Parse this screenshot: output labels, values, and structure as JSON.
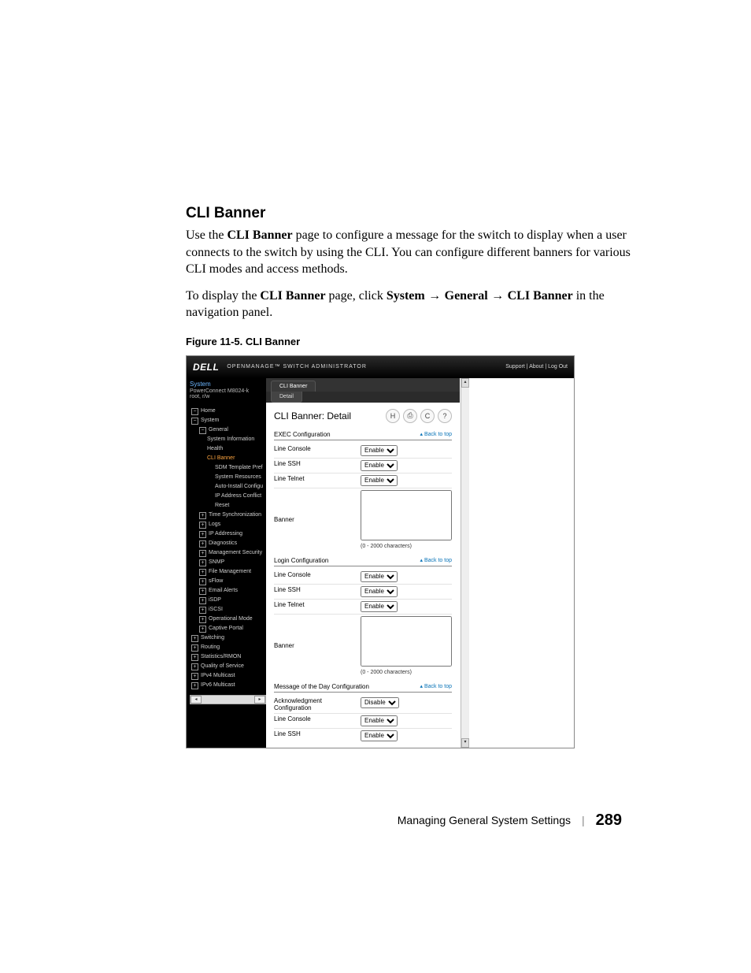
{
  "doc": {
    "heading": "CLI Banner",
    "para1_a": "Use the ",
    "para1_b": "CLI Banner",
    "para1_c": " page to configure a message for the switch to display when a user connects to the switch by using the CLI. You can configure different banners for various CLI modes and access methods.",
    "para2_a": "To display the ",
    "para2_b": "CLI Banner",
    "para2_c": " page, click ",
    "nav1": "System",
    "nav2": "General",
    "nav3": "CLI Banner",
    "para2_d": " in the navigation panel.",
    "figcaption": "Figure 11-5.    CLI Banner"
  },
  "top": {
    "logo": "DELL",
    "subtitle": "OPENMANAGE™  SWITCH  ADMINISTRATOR",
    "links": "Support  |  About  |  Log Out"
  },
  "side": {
    "system": "System",
    "device": "PowerConnect M8024-k",
    "user": "root, r/w",
    "items": {
      "home": "Home",
      "system2": "System",
      "general": "General",
      "sysinfo": "System Information",
      "health": "Health",
      "cli": "CLI Banner",
      "sdm": "SDM Template Pref",
      "sysres": "System Resources",
      "auto": "Auto-Install Configu",
      "ipconf": "IP Address Conflict",
      "reset": "Reset",
      "time": "Time Synchronization",
      "logs": "Logs",
      "ipaddr": "IP Addressing",
      "diag": "Diagnostics",
      "mgmtsec": "Management Security",
      "snmp": "SNMP",
      "filem": "File Management",
      "sflow": "sFlow",
      "email": "Email Alerts",
      "isdp": "iSDP",
      "iscsi": "iSCSI",
      "opmode": "Operational Mode",
      "cportal": "Captive Portal",
      "switching": "Switching",
      "routing": "Routing",
      "stats": "Statistics/RMON",
      "qos": "Quality of Service",
      "ipv4m": "IPv4 Multicast",
      "ipv6m": "IPv6 Multicast"
    }
  },
  "tabs": {
    "main": "CLI Banner",
    "sub": "Detail"
  },
  "panel": {
    "title": "CLI Banner: Detail",
    "back": "Back to top",
    "hint": "(0 - 2000 characters)",
    "sections": {
      "exec": "EXEC Configuration",
      "login": "Login Configuration",
      "motd": "Message of the Day Configuration"
    },
    "fields": {
      "console": "Line Console",
      "ssh": "Line SSH",
      "telnet": "Line Telnet",
      "banner": "Banner",
      "ack": "Acknowledgment Configuration"
    },
    "opts": {
      "enable": "Enable",
      "disable": "Disable"
    }
  },
  "footer": {
    "label": "Managing General System Settings",
    "page": "289"
  }
}
